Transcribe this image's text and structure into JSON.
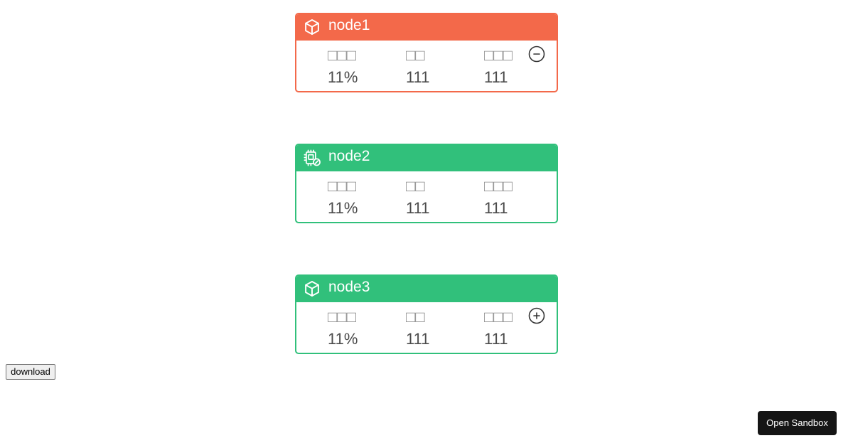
{
  "nodes": [
    {
      "title": "node1",
      "status": "error",
      "icon": "cube-icon",
      "accent_color": "#f3694a",
      "metrics": [
        {
          "label": "□□□",
          "value": "11%"
        },
        {
          "label": "□□",
          "value": "111"
        },
        {
          "label": "□□□",
          "value": "111"
        }
      ],
      "toggle": "collapse"
    },
    {
      "title": "node2",
      "status": "ok",
      "icon": "chip-icon",
      "accent_color": "#31c07b",
      "metrics": [
        {
          "label": "□□□",
          "value": "11%"
        },
        {
          "label": "□□",
          "value": "111"
        },
        {
          "label": "□□□",
          "value": "111"
        }
      ]
    },
    {
      "title": "node3",
      "status": "ok",
      "icon": "cube-icon",
      "accent_color": "#31c07b",
      "metrics": [
        {
          "label": "□□□",
          "value": "11%"
        },
        {
          "label": "□□",
          "value": "111"
        },
        {
          "label": "□□□",
          "value": "111"
        }
      ],
      "toggle": "expand"
    }
  ],
  "download_label": "download",
  "sandbox_label": "Open Sandbox"
}
